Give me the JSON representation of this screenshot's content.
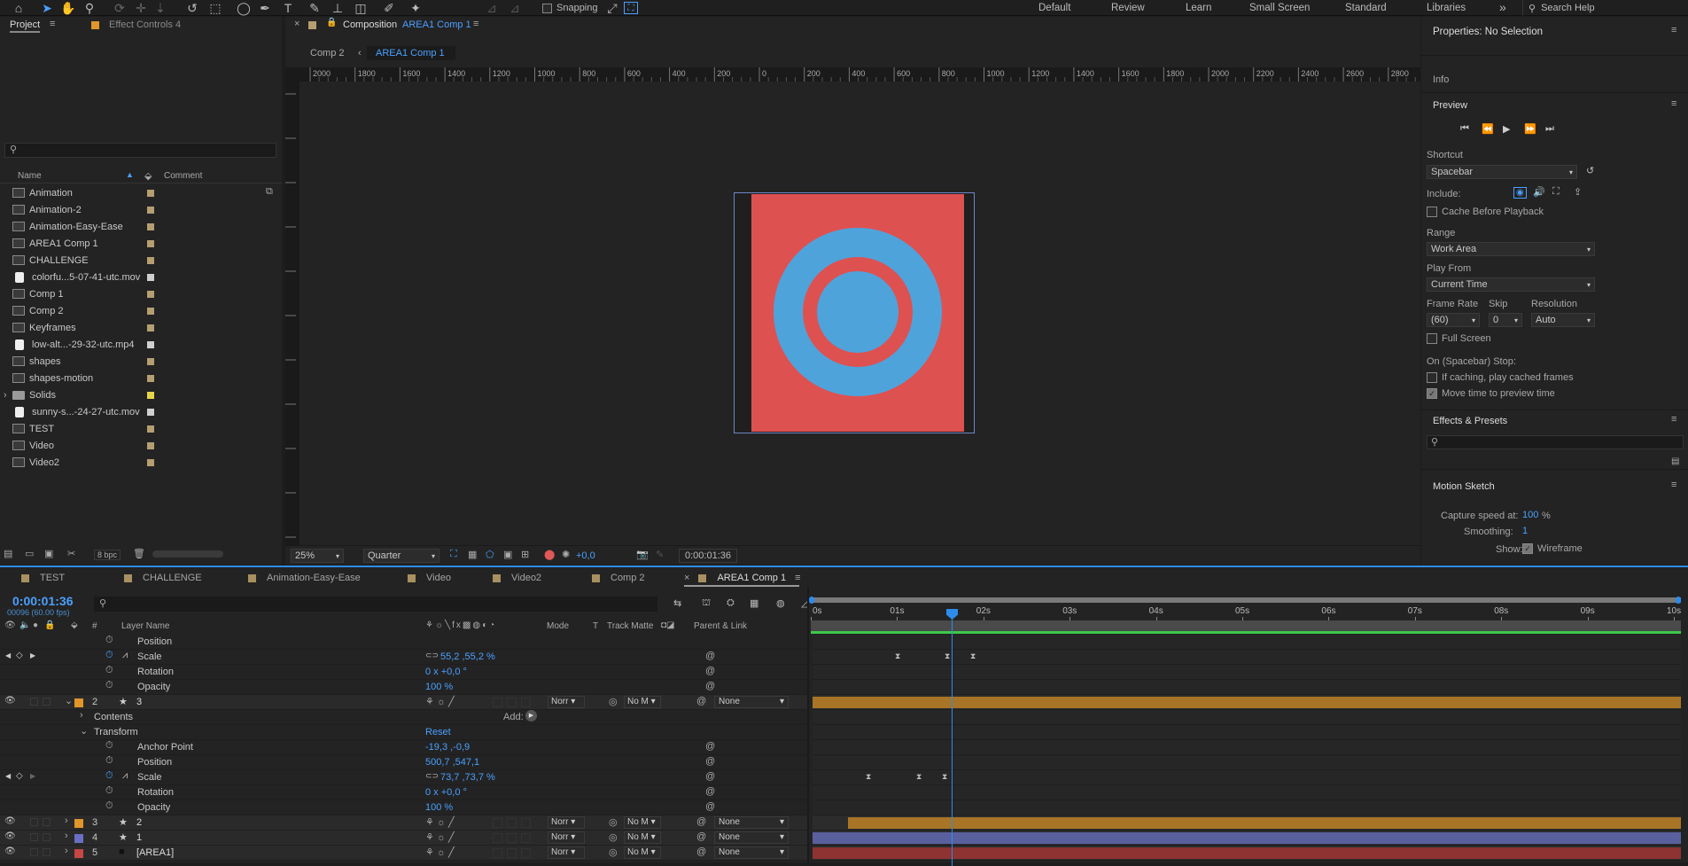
{
  "colors": {
    "accent": "#2d8ceb",
    "orange": "#e0962a",
    "bar_orange": "#a87425",
    "bar_purple": "#5a5f9e",
    "bar_red": "#8e3232",
    "canvas_red": "#dd5151",
    "canvas_blue": "#4fa3db"
  },
  "toolbar": {
    "snapping_label": "Snapping",
    "workspaces": [
      "Default",
      "Review",
      "Learn",
      "Small Screen",
      "Standard",
      "Libraries"
    ],
    "overflow": "»",
    "search_placeholder": "Search Help"
  },
  "project_panel": {
    "tab_project": "Project",
    "tab_effect_controls": "Effect Controls 4",
    "search_placeholder": "",
    "col_name": "Name",
    "col_comment": "Comment",
    "items": [
      {
        "name": "Animation",
        "type": "comp",
        "label": "#b59e72"
      },
      {
        "name": "Animation-2",
        "type": "comp",
        "label": "#b59e72"
      },
      {
        "name": "Animation-Easy-Ease",
        "type": "comp",
        "label": "#b59e72"
      },
      {
        "name": "AREA1 Comp 1",
        "type": "comp",
        "label": "#b59e72"
      },
      {
        "name": "CHALLENGE",
        "type": "comp",
        "label": "#b59e72"
      },
      {
        "name": "colorfu...5-07-41-utc.mov",
        "type": "video",
        "label": "#cfcfcf"
      },
      {
        "name": "Comp 1",
        "type": "comp",
        "label": "#b59e72"
      },
      {
        "name": "Comp 2",
        "type": "comp",
        "label": "#b59e72"
      },
      {
        "name": "Keyframes",
        "type": "comp",
        "label": "#b59e72"
      },
      {
        "name": "low-alt...-29-32-utc.mp4",
        "type": "video",
        "label": "#cfcfcf"
      },
      {
        "name": "shapes",
        "type": "comp",
        "label": "#b59e72"
      },
      {
        "name": "shapes-motion",
        "type": "comp",
        "label": "#b59e72"
      },
      {
        "name": "Solids",
        "type": "folder",
        "label": "#e8d44a"
      },
      {
        "name": "sunny-s...-24-27-utc.mov",
        "type": "video",
        "label": "#cfcfcf"
      },
      {
        "name": "TEST",
        "type": "comp",
        "label": "#b59e72"
      },
      {
        "name": "Video",
        "type": "comp",
        "label": "#b59e72"
      },
      {
        "name": "Video2",
        "type": "comp",
        "label": "#b59e72"
      }
    ],
    "bpc": "8 bpc"
  },
  "composition": {
    "close": "×",
    "title_prefix": "Composition",
    "title_name": "AREA1 Comp 1",
    "crumb_1": "Comp 2",
    "crumb_2": "AREA1 Comp 1",
    "ruler_labels": [
      "2000",
      "1800",
      "1600",
      "1400",
      "1200",
      "1000",
      "800",
      "600",
      "400",
      "200",
      "0",
      "200",
      "400",
      "600",
      "800",
      "1000",
      "1200",
      "1400",
      "1600",
      "1800",
      "2000",
      "2200",
      "2400",
      "2600",
      "2800"
    ],
    "zoom": "25%",
    "resolution": "Quarter",
    "exposure": "+0,0",
    "timecode": "0:00:01:36"
  },
  "properties": {
    "title": "Properties: No Selection",
    "info": "Info",
    "preview": "Preview",
    "shortcut_label": "Shortcut",
    "shortcut_value": "Spacebar",
    "include_label": "Include:",
    "cache_before": "Cache Before Playback",
    "range_label": "Range",
    "range_value": "Work Area",
    "play_from_label": "Play From",
    "play_from_value": "Current Time",
    "frame_rate_label": "Frame Rate",
    "frame_rate_value": "(60)",
    "skip_label": "Skip",
    "skip_value": "0",
    "resolution_label": "Resolution",
    "resolution_value": "Auto",
    "full_screen": "Full Screen",
    "on_stop": "On (Spacebar) Stop:",
    "if_caching": "If caching, play cached frames",
    "move_time": "Move time to preview time",
    "effects_presets": "Effects & Presets",
    "motion_sketch": "Motion Sketch",
    "capture_label": "Capture speed at:",
    "capture_value": "100",
    "capture_unit": "%",
    "smoothing_label": "Smoothing:",
    "smoothing_value": "1",
    "show_label": "Show:",
    "wireframe": "Wireframe"
  },
  "timeline": {
    "tabs": [
      "TEST",
      "CHALLENGE",
      "Animation-Easy-Ease",
      "Video",
      "Video2",
      "Comp 2",
      "AREA1 Comp 1"
    ],
    "timecode": "0:00:01:36",
    "frames": "00096 (60.00 fps)",
    "col_num": "#",
    "col_layer_name": "Layer Name",
    "col_mode": "Mode",
    "col_t": "T",
    "col_track_matte": "Track Matte",
    "col_parent": "Parent & Link",
    "time_labels": [
      "0s",
      "01s",
      "02s",
      "03s",
      "04s",
      "05s",
      "06s",
      "07s",
      "08s",
      "09s",
      "10s"
    ],
    "rows": [
      {
        "kind": "prop",
        "name": "Position",
        "value": "",
        "cut": true
      },
      {
        "kind": "prop",
        "name": "Scale",
        "value": "55,2 ,55,2 %",
        "kf": true,
        "chain": true
      },
      {
        "kind": "prop",
        "name": "Rotation",
        "value": "0 x +0,0 °"
      },
      {
        "kind": "prop",
        "name": "Opacity",
        "value": "100 %"
      },
      {
        "kind": "layer",
        "num": "2",
        "name": "3",
        "label": "#e0962a",
        "mode": "Norr",
        "matte": "No M",
        "parent": "None",
        "bar": "orange"
      },
      {
        "kind": "group",
        "name": "Contents",
        "add": "Add:"
      },
      {
        "kind": "group",
        "name": "Transform",
        "value": "Reset",
        "open": true
      },
      {
        "kind": "prop",
        "name": "Anchor Point",
        "value": "-19,3 ,-0,9"
      },
      {
        "kind": "prop",
        "name": "Position",
        "value": "500,7 ,547,1"
      },
      {
        "kind": "prop",
        "name": "Scale",
        "value": "73,7 ,73,7 %",
        "kf": true,
        "chain": true
      },
      {
        "kind": "prop",
        "name": "Rotation",
        "value": "0 x +0,0 °"
      },
      {
        "kind": "prop",
        "name": "Opacity",
        "value": "100 %"
      },
      {
        "kind": "layer",
        "num": "3",
        "name": "2",
        "label": "#e0962a",
        "mode": "Norr",
        "matte": "No M",
        "parent": "None",
        "bar": "orange"
      },
      {
        "kind": "layer",
        "num": "4",
        "name": "1",
        "label": "#6a6fc4",
        "mode": "Norr",
        "matte": "No M",
        "parent": "None",
        "bar": "purple"
      },
      {
        "kind": "layer",
        "num": "5",
        "name": "[AREA1]",
        "label": "#c74646",
        "mode": "Norr",
        "matte": "No M",
        "parent": "None",
        "bar": "red"
      }
    ]
  }
}
